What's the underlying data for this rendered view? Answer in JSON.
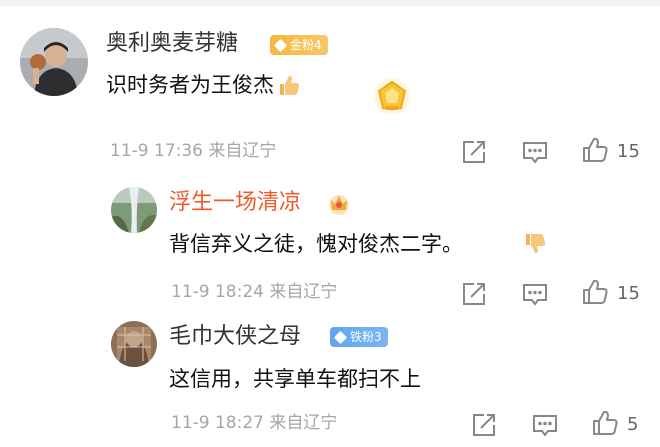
{
  "comments": [
    {
      "username": "奥利奥麦芽糖",
      "badge": {
        "label": "金粉4",
        "color": "#f5b83e"
      },
      "text": "识时务者为王俊杰",
      "emoji": "thumbs-up-icon",
      "meta": "11-9 17:36  来自辽宁",
      "likes": "15"
    },
    {
      "username": "浮生一场清凉",
      "name_color": "#f05a2b",
      "text": "背信弃义之徒，愧对俊杰二字。",
      "emoji": "thumbs-down-icon",
      "meta": "11-9 18:24  来自辽宁",
      "likes": "15"
    },
    {
      "username": "毛巾大侠之母",
      "badge": {
        "label": "铁粉3",
        "color": "#62a5ee"
      },
      "text": "这信用，共享单车都扫不上",
      "meta": "11-9 18:27  来自辽宁",
      "likes": "5"
    }
  ]
}
